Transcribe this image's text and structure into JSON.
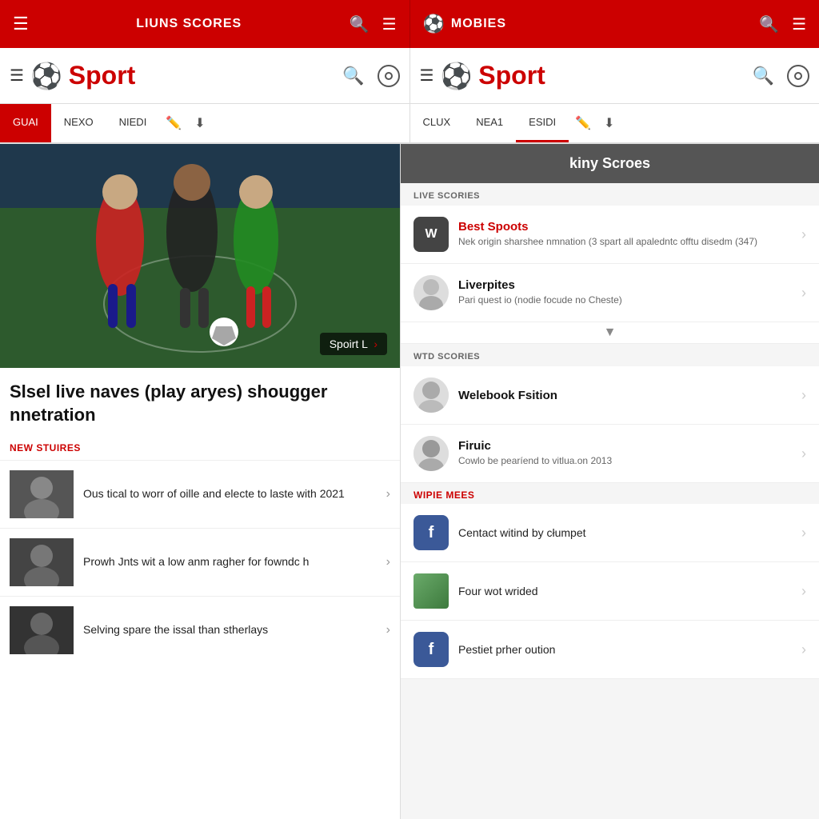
{
  "app": {
    "left_app_name": "LIUNS SCORES",
    "right_app_name": "MOBIES",
    "brand_title": "Sport"
  },
  "tabs": {
    "left": [
      {
        "label": "GUAI",
        "active": true
      },
      {
        "label": "NEXO",
        "active": false
      },
      {
        "label": "NIEDI",
        "active": false
      }
    ],
    "right": [
      {
        "label": "CLUX",
        "active": false
      },
      {
        "label": "NEA1",
        "active": false
      },
      {
        "label": "ESIDI",
        "active": true,
        "underline": true
      }
    ]
  },
  "left": {
    "hero_badge": "Spoirt L",
    "main_headline": "Slsel live naves (play aryes) shougger nnetration",
    "new_stories_label": "NEW STUIRES",
    "news_items": [
      {
        "text": "Ous tical to worr of oille and electe to laste with 2021"
      },
      {
        "text": "Prowh Jnts wit a low anm ragher for fowndc h"
      },
      {
        "text": "Selving spare the issal than stherlays"
      }
    ]
  },
  "right": {
    "scores_header": "kiny Scroes",
    "live_section_label": "LIVE SCORIES",
    "live_items": [
      {
        "badge_letter": "W",
        "title": "Best Spoots",
        "title_red": true,
        "subtitle": "Nek origin sharshee nmnation (3 spart all apaledntc offtu disedm (347)"
      },
      {
        "title": "Liverpites",
        "subtitle": "Pari quest io (nodie focude no Cheste)"
      }
    ],
    "wtd_section_label": "WTD SCORIES",
    "wtd_items": [
      {
        "title": "Welebook Fsition",
        "subtitle": ""
      },
      {
        "title": "Firuic",
        "subtitle": "Cowlo be pearíend to vitlua.on 2013"
      }
    ],
    "wipie_label": "WIPIE MEES",
    "media_items": [
      {
        "type": "facebook",
        "text": "Centact witind by cłumpet"
      },
      {
        "type": "image",
        "text": "Four wot wrided"
      },
      {
        "type": "facebook",
        "text": "Pestiet prher oution"
      }
    ]
  }
}
